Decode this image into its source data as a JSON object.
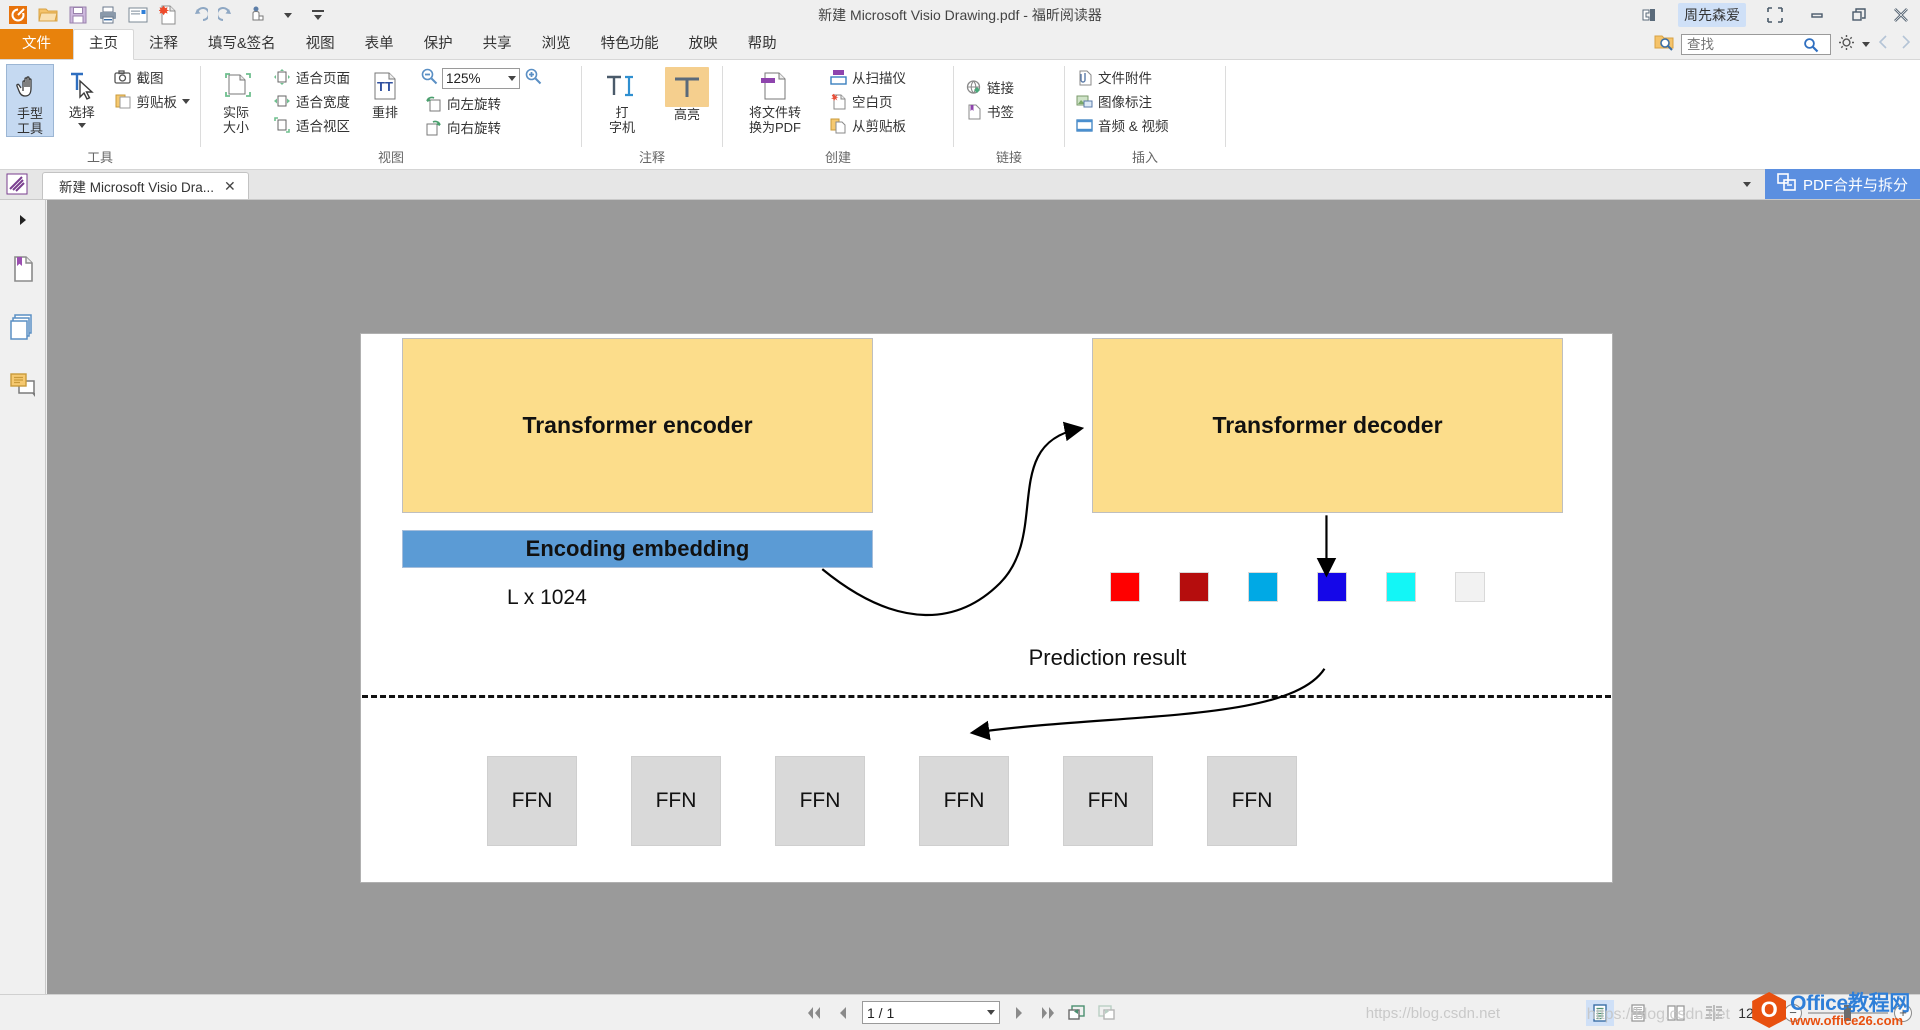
{
  "titlebar": {
    "title": "新建 Microsoft Visio Drawing.pdf - 福昕阅读器",
    "user": "周先森爱",
    "quick_access": [
      {
        "name": "app-logo-icon",
        "label": "福昕"
      },
      {
        "name": "open-icon",
        "label": "打开"
      },
      {
        "name": "save-icon",
        "label": "保存"
      },
      {
        "name": "print-icon",
        "label": "打印"
      },
      {
        "name": "email-icon",
        "label": "邮件"
      },
      {
        "name": "new-from-file-icon",
        "label": "新建"
      },
      {
        "name": "undo-icon",
        "label": "撤销"
      },
      {
        "name": "redo-icon",
        "label": "重做"
      },
      {
        "name": "touch-mode-icon",
        "label": "触摸模式"
      }
    ],
    "window_buttons": [
      {
        "name": "restore-layout-icon",
        "label": "还原布局"
      },
      {
        "name": "minimize-button",
        "label": "最小化"
      },
      {
        "name": "maximize-button",
        "label": "最大化"
      },
      {
        "name": "close-button",
        "label": "关闭"
      }
    ]
  },
  "tabs": [
    {
      "label": "文件",
      "kind": "file"
    },
    {
      "label": "主页",
      "kind": "active"
    },
    {
      "label": "注释",
      "kind": "normal"
    },
    {
      "label": "填写&签名",
      "kind": "normal"
    },
    {
      "label": "视图",
      "kind": "normal"
    },
    {
      "label": "表单",
      "kind": "normal"
    },
    {
      "label": "保护",
      "kind": "normal"
    },
    {
      "label": "共享",
      "kind": "normal"
    },
    {
      "label": "浏览",
      "kind": "normal"
    },
    {
      "label": "特色功能",
      "kind": "normal"
    },
    {
      "label": "放映",
      "kind": "normal"
    },
    {
      "label": "帮助",
      "kind": "normal"
    }
  ],
  "search": {
    "placeholder": "查找",
    "value": "",
    "search_icon": "search-icon",
    "settings_icon": "gear-icon"
  },
  "ribbon": {
    "groups": [
      {
        "label": "工具",
        "big": [
          {
            "label": "手型\n工具",
            "line1": "手型",
            "line2": "工具",
            "icon": "hand-tool-icon",
            "selected": true
          },
          {
            "label": "选择",
            "line1": "选择",
            "line2": "",
            "icon": "select-tool-icon",
            "selected": false,
            "dropdown": true
          }
        ],
        "small": [
          {
            "label": "截图",
            "icon": "camera-icon"
          },
          {
            "label": "剪贴板",
            "icon": "clipboard-icon",
            "dropdown": true
          }
        ]
      },
      {
        "label": "视图",
        "big": [
          {
            "line1": "实际",
            "line2": "大小",
            "icon": "actual-size-icon",
            "selected": false
          }
        ],
        "small": [
          {
            "label": "适合页面",
            "icon": "fit-page-icon"
          },
          {
            "label": "适合宽度",
            "icon": "fit-width-icon"
          },
          {
            "label": "适合视区",
            "icon": "fit-visible-icon"
          }
        ],
        "big2": [
          {
            "line1": "重排",
            "line2": "",
            "icon": "reflow-icon"
          }
        ],
        "zoom": {
          "value": "125%",
          "zoom_out_icon": "zoom-out-icon",
          "zoom_in_icon": "zoom-in-icon"
        },
        "small2": [
          {
            "label": "向左旋转",
            "icon": "rotate-left-icon"
          },
          {
            "label": "向右旋转",
            "icon": "rotate-right-icon"
          }
        ]
      },
      {
        "label": "注释",
        "big": [
          {
            "line1": "打",
            "line2": "字机",
            "icon": "typewriter-icon",
            "selected": false
          },
          {
            "line1": "高亮",
            "line2": "",
            "icon": "highlight-icon",
            "selected": true
          }
        ]
      },
      {
        "label": "创建",
        "big": [
          {
            "line1": "将文件转",
            "line2": "换为PDF",
            "icon": "file-to-pdf-icon"
          }
        ],
        "small": [
          {
            "label": "从扫描仪",
            "icon": "scanner-icon"
          },
          {
            "label": "空白页",
            "icon": "blank-page-icon"
          },
          {
            "label": "从剪贴板",
            "icon": "from-clipboard-icon"
          }
        ]
      },
      {
        "label": "链接",
        "small": [
          {
            "label": "链接",
            "icon": "link-icon"
          },
          {
            "label": "书签",
            "icon": "bookmark-icon"
          }
        ]
      },
      {
        "label": "插入",
        "small": [
          {
            "label": "文件附件",
            "icon": "attachment-icon"
          },
          {
            "label": "图像标注",
            "icon": "image-annotation-icon"
          },
          {
            "label": "音频 & 视频",
            "icon": "audio-video-icon"
          }
        ]
      }
    ]
  },
  "doctabs": {
    "app_icon": "foxit-icon",
    "tab_label": "新建 Microsoft Visio Dra...",
    "close_label": "✕",
    "dropdown_icon": "chevron-down-icon",
    "pdf_merge_label": "PDF合并与拆分",
    "pdf_merge_icon": "merge-split-icon"
  },
  "left_rail": {
    "expand_icon": "expand-arrow-icon",
    "items": [
      {
        "name": "bookmark-panel-icon",
        "label": "书签"
      },
      {
        "name": "pages-panel-icon",
        "label": "页面缩略图"
      },
      {
        "name": "comments-panel-icon",
        "label": "注释"
      }
    ]
  },
  "document": {
    "encoder_label": "Transformer encoder",
    "decoder_label": "Transformer decoder",
    "embedding_label": "Encoding embedding",
    "dimension_label": "L x 1024",
    "prediction_label": "Prediction result",
    "squares": [
      {
        "name": "square-red",
        "color": "#ff0000"
      },
      {
        "name": "square-dark-red",
        "color": "#b50d0d"
      },
      {
        "name": "square-light-blue",
        "color": "#00a9e5"
      },
      {
        "name": "square-blue",
        "color": "#1507e8"
      },
      {
        "name": "square-cyan",
        "color": "#13f6f6"
      },
      {
        "name": "square-white",
        "color": "#f2f2f2"
      }
    ],
    "ffn_boxes": [
      "FFN",
      "FFN",
      "FFN",
      "FFN",
      "FFN",
      "FFN"
    ]
  },
  "statusbar": {
    "first_page_icon": "first-page-icon",
    "prev_page_icon": "prev-page-icon",
    "page_value": "1 / 1",
    "next_page_icon": "next-page-icon",
    "last_page_icon": "last-page-icon",
    "prev_view_icon": "previous-view-icon",
    "next_view_icon": "next-view-icon",
    "view_modes": [
      {
        "name": "single-page-view-icon",
        "selected": true
      },
      {
        "name": "continuous-view-icon",
        "selected": false
      },
      {
        "name": "facing-view-icon",
        "selected": false
      },
      {
        "name": "continuous-facing-view-icon",
        "selected": false
      }
    ],
    "zoom_percent": "125%",
    "zoom_out_icon": "zoom-out-icon",
    "zoom_in_icon": "zoom-in-icon"
  },
  "watermark": {
    "brand_top": "Office教程网",
    "brand_bottom": "www.office26.com",
    "logo_glyph": "O",
    "faint_text": "https://blog.csdn.net",
    "faint_text2": "https://blog.csdn.net"
  }
}
